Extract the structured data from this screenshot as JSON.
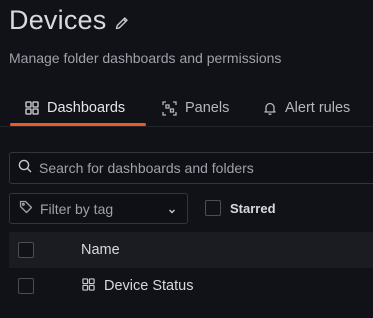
{
  "header": {
    "title": "Devices",
    "subtitle": "Manage folder dashboards and permissions",
    "edit_icon": "pencil-icon"
  },
  "tabs": [
    {
      "label": "Dashboards",
      "icon": "apps-grid-icon",
      "active": true
    },
    {
      "label": "Panels",
      "icon": "library-panel-icon",
      "active": false
    },
    {
      "label": "Alert rules",
      "icon": "bell-icon",
      "active": false
    }
  ],
  "search": {
    "placeholder": "Search for dashboards and folders",
    "icon": "search-icon"
  },
  "filters": {
    "tag_placeholder": "Filter by tag",
    "tag_icon": "tag-icon",
    "starred_label": "Starred",
    "starred_checked": false
  },
  "table": {
    "columns": [
      "Name"
    ],
    "rows": [
      {
        "name": "Device Status",
        "icon": "apps-grid-icon",
        "checked": false
      }
    ]
  },
  "colors": {
    "accent": "#f05a28",
    "background": "#111217",
    "header_row": "#1b1c22"
  }
}
